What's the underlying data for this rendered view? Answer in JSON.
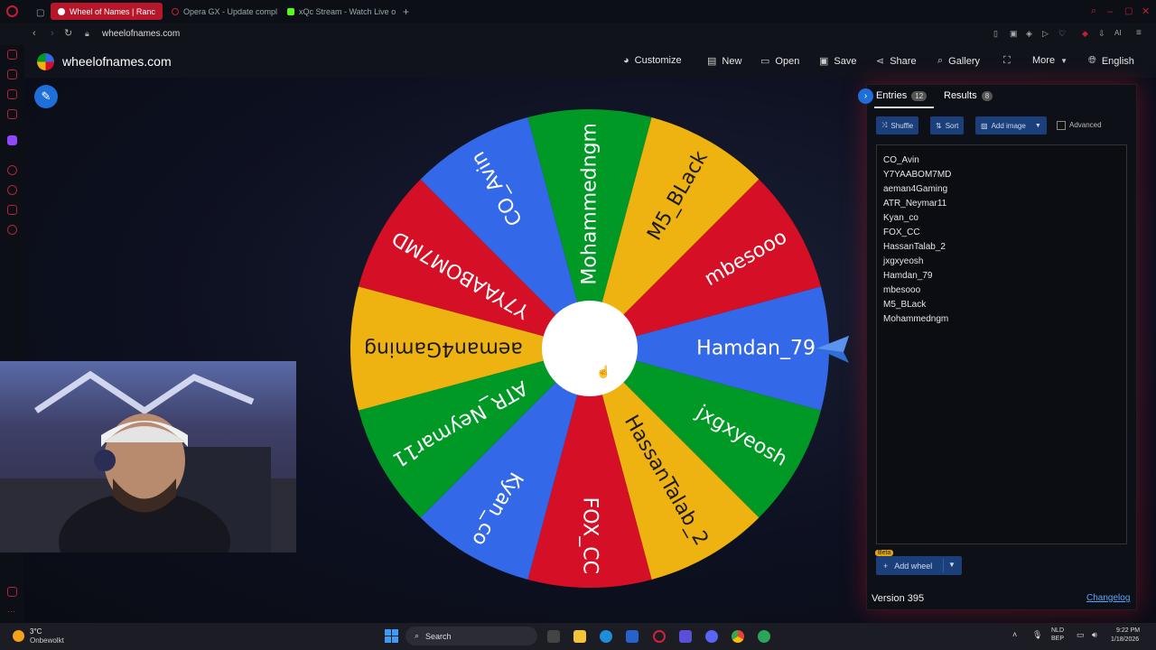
{
  "browser": {
    "tabs": [
      {
        "label": "Wheel of Names | Ranc",
        "active": true
      },
      {
        "label": "Opera GX - Update compl",
        "active": false
      },
      {
        "label": "xQc Stream - Watch Live o",
        "active": false
      }
    ],
    "url": "wheelofnames.com"
  },
  "site": {
    "title": "wheelofnames.com",
    "nav": {
      "customize": "Customize",
      "new": "New",
      "open": "Open",
      "save": "Save",
      "share": "Share",
      "gallery": "Gallery",
      "more": "More",
      "language": "English"
    }
  },
  "wheel": {
    "colors": [
      "#3369e8",
      "#009925",
      "#eeb211",
      "#d50f25"
    ],
    "segments": [
      "Hamdan_79",
      "jxgxyeosh",
      "HassanTalab_2",
      "FOX_CC",
      "Kyan_co",
      "ATR_Neymar11",
      "aeman4Gaming",
      "Y7YAABOM7MD",
      "CO_Avin",
      "Mohammedngm",
      "M5_BLack",
      "mbesooo"
    ]
  },
  "panel": {
    "entries_tab": "Entries",
    "entries_count": "12",
    "results_tab": "Results",
    "results_count": "8",
    "shuffle": "Shuffle",
    "sort": "Sort",
    "add_image": "Add image",
    "advanced": "Advanced",
    "entries": [
      "CO_Avin",
      "Y7YAABOM7MD",
      "aeman4Gaming",
      "ATR_Neymar11",
      "Kyan_co",
      "FOX_CC",
      "HassanTalab_2",
      "jxgxyeosh",
      "Hamdan_79",
      "mbesooo",
      "M5_BLack",
      "Mohammedngm"
    ],
    "beta": "Beta",
    "add_wheel": "Add wheel",
    "version": "Version 395",
    "changelog": "Changelog"
  },
  "taskbar": {
    "weather_temp": "3°C",
    "weather_desc": "Onbewolkt",
    "search": "Search",
    "lang_line1": "NLD",
    "lang_line2": "BEP",
    "time": "9:22 PM",
    "date": "1/18/2026"
  }
}
